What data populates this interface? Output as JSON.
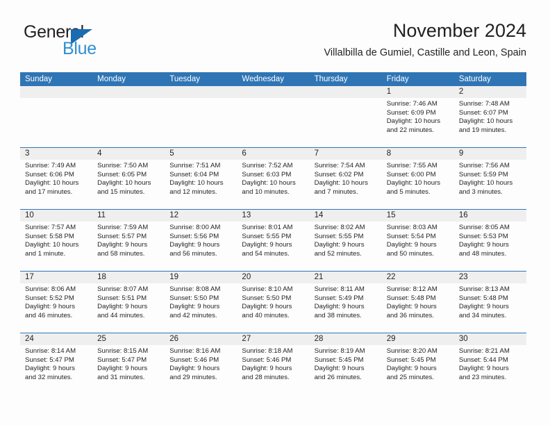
{
  "brand": {
    "name_top": "General",
    "name_bottom": "Blue",
    "triangle_color": "#1b6cb0",
    "blue_text_color": "#2e8fd4"
  },
  "header": {
    "title": "November 2024",
    "subtitle": "Villalbilla de Gumiel, Castille and Leon, Spain"
  },
  "theme": {
    "header_blue": "#2f75b5",
    "daynum_band": "#efefef",
    "text": "#231f20",
    "page_bg": "#fdfdfd"
  },
  "weekday_headers": [
    "Sunday",
    "Monday",
    "Tuesday",
    "Wednesday",
    "Thursday",
    "Friday",
    "Saturday"
  ],
  "weeks": [
    [
      {
        "empty": true
      },
      {
        "empty": true
      },
      {
        "empty": true
      },
      {
        "empty": true
      },
      {
        "empty": true
      },
      {
        "day": "1",
        "l1": "Sunrise: 7:46 AM",
        "l2": "Sunset: 6:09 PM",
        "l3": "Daylight: 10 hours",
        "l4": "and 22 minutes."
      },
      {
        "day": "2",
        "l1": "Sunrise: 7:48 AM",
        "l2": "Sunset: 6:07 PM",
        "l3": "Daylight: 10 hours",
        "l4": "and 19 minutes."
      }
    ],
    [
      {
        "day": "3",
        "l1": "Sunrise: 7:49 AM",
        "l2": "Sunset: 6:06 PM",
        "l3": "Daylight: 10 hours",
        "l4": "and 17 minutes."
      },
      {
        "day": "4",
        "l1": "Sunrise: 7:50 AM",
        "l2": "Sunset: 6:05 PM",
        "l3": "Daylight: 10 hours",
        "l4": "and 15 minutes."
      },
      {
        "day": "5",
        "l1": "Sunrise: 7:51 AM",
        "l2": "Sunset: 6:04 PM",
        "l3": "Daylight: 10 hours",
        "l4": "and 12 minutes."
      },
      {
        "day": "6",
        "l1": "Sunrise: 7:52 AM",
        "l2": "Sunset: 6:03 PM",
        "l3": "Daylight: 10 hours",
        "l4": "and 10 minutes."
      },
      {
        "day": "7",
        "l1": "Sunrise: 7:54 AM",
        "l2": "Sunset: 6:02 PM",
        "l3": "Daylight: 10 hours",
        "l4": "and 7 minutes."
      },
      {
        "day": "8",
        "l1": "Sunrise: 7:55 AM",
        "l2": "Sunset: 6:00 PM",
        "l3": "Daylight: 10 hours",
        "l4": "and 5 minutes."
      },
      {
        "day": "9",
        "l1": "Sunrise: 7:56 AM",
        "l2": "Sunset: 5:59 PM",
        "l3": "Daylight: 10 hours",
        "l4": "and 3 minutes."
      }
    ],
    [
      {
        "day": "10",
        "l1": "Sunrise: 7:57 AM",
        "l2": "Sunset: 5:58 PM",
        "l3": "Daylight: 10 hours",
        "l4": "and 1 minute."
      },
      {
        "day": "11",
        "l1": "Sunrise: 7:59 AM",
        "l2": "Sunset: 5:57 PM",
        "l3": "Daylight: 9 hours",
        "l4": "and 58 minutes."
      },
      {
        "day": "12",
        "l1": "Sunrise: 8:00 AM",
        "l2": "Sunset: 5:56 PM",
        "l3": "Daylight: 9 hours",
        "l4": "and 56 minutes."
      },
      {
        "day": "13",
        "l1": "Sunrise: 8:01 AM",
        "l2": "Sunset: 5:55 PM",
        "l3": "Daylight: 9 hours",
        "l4": "and 54 minutes."
      },
      {
        "day": "14",
        "l1": "Sunrise: 8:02 AM",
        "l2": "Sunset: 5:55 PM",
        "l3": "Daylight: 9 hours",
        "l4": "and 52 minutes."
      },
      {
        "day": "15",
        "l1": "Sunrise: 8:03 AM",
        "l2": "Sunset: 5:54 PM",
        "l3": "Daylight: 9 hours",
        "l4": "and 50 minutes."
      },
      {
        "day": "16",
        "l1": "Sunrise: 8:05 AM",
        "l2": "Sunset: 5:53 PM",
        "l3": "Daylight: 9 hours",
        "l4": "and 48 minutes."
      }
    ],
    [
      {
        "day": "17",
        "l1": "Sunrise: 8:06 AM",
        "l2": "Sunset: 5:52 PM",
        "l3": "Daylight: 9 hours",
        "l4": "and 46 minutes."
      },
      {
        "day": "18",
        "l1": "Sunrise: 8:07 AM",
        "l2": "Sunset: 5:51 PM",
        "l3": "Daylight: 9 hours",
        "l4": "and 44 minutes."
      },
      {
        "day": "19",
        "l1": "Sunrise: 8:08 AM",
        "l2": "Sunset: 5:50 PM",
        "l3": "Daylight: 9 hours",
        "l4": "and 42 minutes."
      },
      {
        "day": "20",
        "l1": "Sunrise: 8:10 AM",
        "l2": "Sunset: 5:50 PM",
        "l3": "Daylight: 9 hours",
        "l4": "and 40 minutes."
      },
      {
        "day": "21",
        "l1": "Sunrise: 8:11 AM",
        "l2": "Sunset: 5:49 PM",
        "l3": "Daylight: 9 hours",
        "l4": "and 38 minutes."
      },
      {
        "day": "22",
        "l1": "Sunrise: 8:12 AM",
        "l2": "Sunset: 5:48 PM",
        "l3": "Daylight: 9 hours",
        "l4": "and 36 minutes."
      },
      {
        "day": "23",
        "l1": "Sunrise: 8:13 AM",
        "l2": "Sunset: 5:48 PM",
        "l3": "Daylight: 9 hours",
        "l4": "and 34 minutes."
      }
    ],
    [
      {
        "day": "24",
        "l1": "Sunrise: 8:14 AM",
        "l2": "Sunset: 5:47 PM",
        "l3": "Daylight: 9 hours",
        "l4": "and 32 minutes."
      },
      {
        "day": "25",
        "l1": "Sunrise: 8:15 AM",
        "l2": "Sunset: 5:47 PM",
        "l3": "Daylight: 9 hours",
        "l4": "and 31 minutes."
      },
      {
        "day": "26",
        "l1": "Sunrise: 8:16 AM",
        "l2": "Sunset: 5:46 PM",
        "l3": "Daylight: 9 hours",
        "l4": "and 29 minutes."
      },
      {
        "day": "27",
        "l1": "Sunrise: 8:18 AM",
        "l2": "Sunset: 5:46 PM",
        "l3": "Daylight: 9 hours",
        "l4": "and 28 minutes."
      },
      {
        "day": "28",
        "l1": "Sunrise: 8:19 AM",
        "l2": "Sunset: 5:45 PM",
        "l3": "Daylight: 9 hours",
        "l4": "and 26 minutes."
      },
      {
        "day": "29",
        "l1": "Sunrise: 8:20 AM",
        "l2": "Sunset: 5:45 PM",
        "l3": "Daylight: 9 hours",
        "l4": "and 25 minutes."
      },
      {
        "day": "30",
        "l1": "Sunrise: 8:21 AM",
        "l2": "Sunset: 5:44 PM",
        "l3": "Daylight: 9 hours",
        "l4": "and 23 minutes."
      }
    ]
  ]
}
